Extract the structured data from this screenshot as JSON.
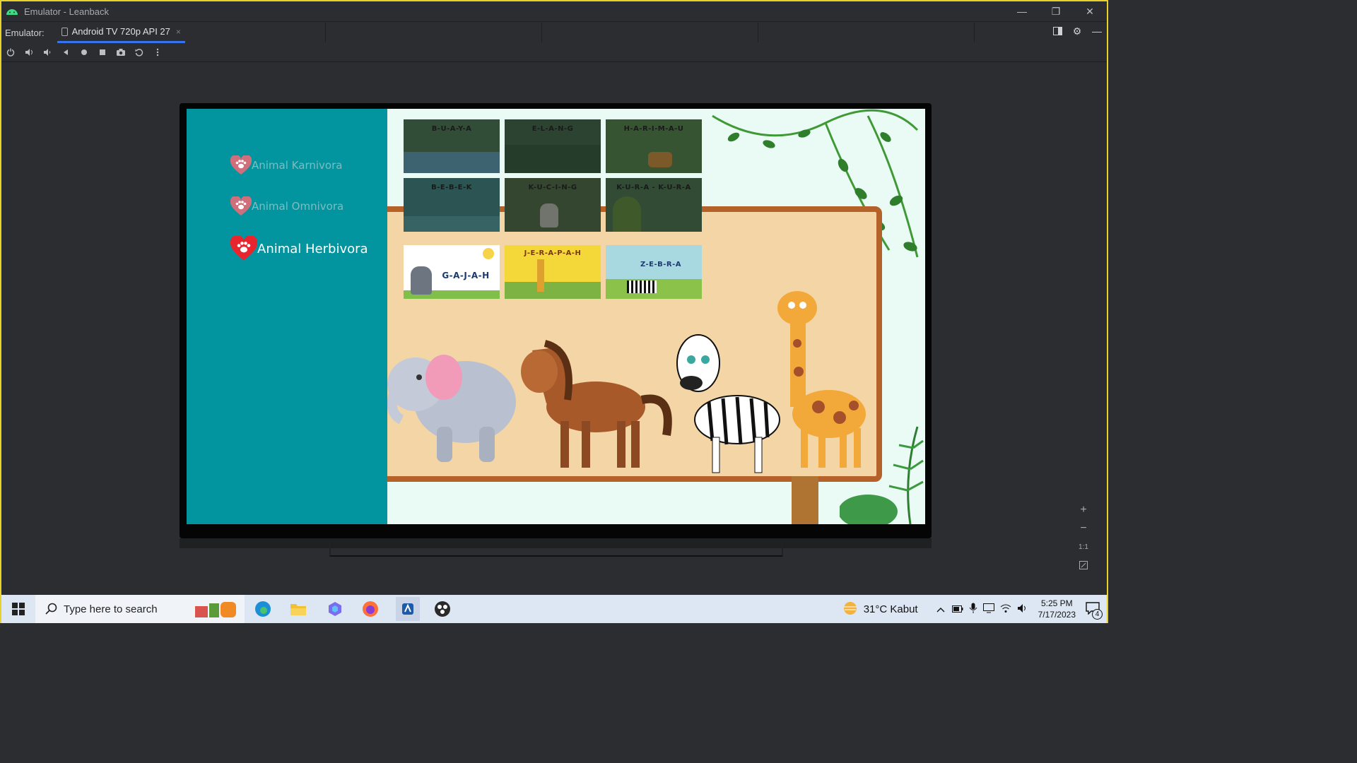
{
  "window": {
    "title": "Emulator - Leanback",
    "minimize": "—",
    "restore": "❐",
    "close": "✕"
  },
  "tabbar": {
    "emulator_label": "Emulator:",
    "device_tab": "Android TV 720p API 27",
    "tab_close": "×"
  },
  "toolbar_icons": [
    "power-icon",
    "volume-up-icon",
    "volume-down-icon",
    "back-icon",
    "home-icon",
    "overview-icon",
    "camera-icon",
    "rotate-icon",
    "more-icon"
  ],
  "app": {
    "menu": [
      {
        "label": "Animal Karnivora",
        "selected": false
      },
      {
        "label": "Animal Omnivora",
        "selected": false
      },
      {
        "label": "Animal Herbivora",
        "selected": true
      }
    ],
    "cards_dimmed": [
      {
        "label": "B-U-A-Y-A",
        "color": "#3c6e4a"
      },
      {
        "label": "E-L-A-N-G",
        "color": "#2f5a3a"
      },
      {
        "label": "H-A-R-I-M-A-U",
        "color": "#4a7f3e"
      },
      {
        "label": "B-E-B-E-K",
        "color": "#2f7f86"
      },
      {
        "label": "K-U-C-I-N-G",
        "color": "#45603b"
      },
      {
        "label": "K-U-R-A - K-U-R-A",
        "color": "#3f6a44"
      }
    ],
    "cards_active": [
      {
        "label": "G-A-J-A-H",
        "color": "#ffffff"
      },
      {
        "label": "J-E-R-A-P-A-H",
        "color": "#f4d83a"
      },
      {
        "label": "Z-E-B-R-A",
        "color": "#a8d8e0"
      }
    ],
    "colors": {
      "menu_bg": "#03959f",
      "heart_active": "#e8242f",
      "heart_dim": "#cf6f7c",
      "sign_wood": "#f4d5a6"
    }
  },
  "zoom": {
    "plus": "+",
    "minus": "−",
    "one_to_one": "1:1"
  },
  "taskbar": {
    "search_placeholder": "Type here to search",
    "weather": "31°C  Kabut",
    "time": "5:25 PM",
    "date": "7/17/2023",
    "notification_count": "4"
  }
}
